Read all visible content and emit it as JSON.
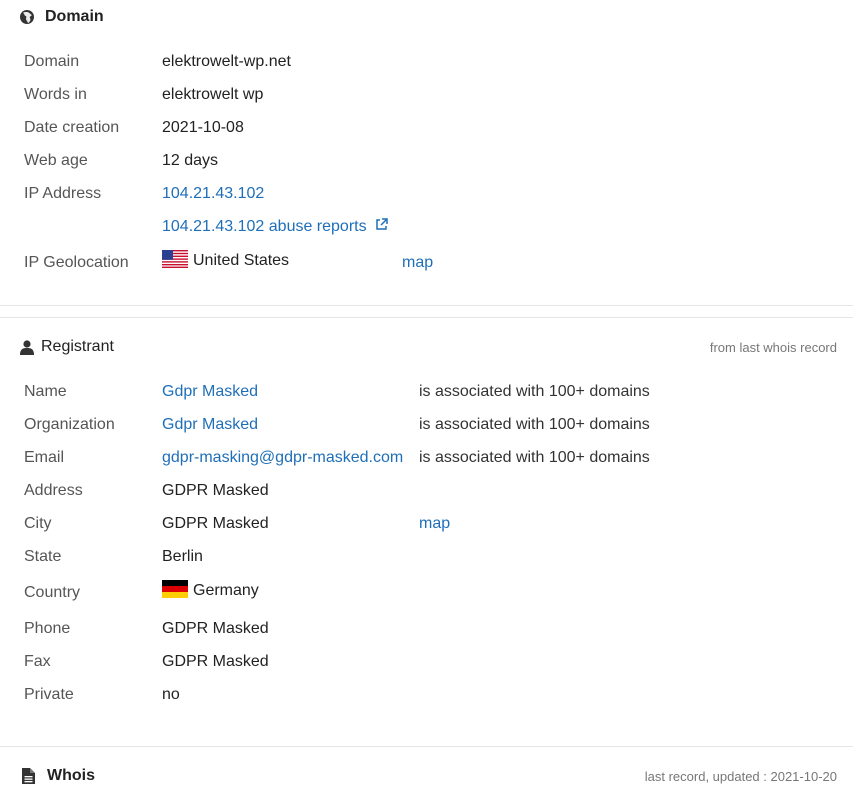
{
  "domain_section": {
    "title": "Domain",
    "rows": [
      {
        "label": "Domain",
        "value": "elektrowelt-wp.net"
      },
      {
        "label": "Words in",
        "value": "elektrowelt wp"
      },
      {
        "label": "Date creation",
        "value": "2021-10-08"
      },
      {
        "label": "Web age",
        "value": "12 days"
      },
      {
        "label": "IP Address",
        "value": "104.21.43.102"
      }
    ],
    "abuse_link": "104.21.43.102 abuse reports",
    "geolocation": {
      "label": "IP Geolocation",
      "country": "United States",
      "map": "map"
    }
  },
  "registrant_section": {
    "title": "Registrant",
    "note": "from last whois record",
    "rows": [
      {
        "label": "Name",
        "value": "Gdpr Masked",
        "extra": "is associated with 100+ domains"
      },
      {
        "label": "Organization",
        "value": "Gdpr Masked",
        "extra": "is associated with 100+ domains"
      },
      {
        "label": "Email",
        "value": "gdpr-masking@gdpr-masked.com",
        "extra": "is associated with 100+ domains"
      },
      {
        "label": "Address",
        "value": "GDPR Masked"
      },
      {
        "label": "City",
        "value": "GDPR Masked",
        "map": "map"
      },
      {
        "label": "State",
        "value": "Berlin"
      },
      {
        "label": "Country",
        "value": "Germany"
      },
      {
        "label": "Phone",
        "value": "GDPR Masked"
      },
      {
        "label": "Fax",
        "value": "GDPR Masked"
      },
      {
        "label": "Private",
        "value": "no"
      }
    ]
  },
  "whois_section": {
    "title": "Whois",
    "note": "last record, updated : 2021-10-20"
  },
  "icons": {
    "domain": "globe-icon",
    "registrant": "user-icon",
    "whois": "document-icon",
    "abuse_link": "external-link-icon",
    "us_flag": "us-flag-icon",
    "de_flag": "germany-flag-icon"
  },
  "colors": {
    "link": "#1f6fb8",
    "label": "#555555",
    "note": "#777777",
    "divider": "#e6e6e6"
  }
}
